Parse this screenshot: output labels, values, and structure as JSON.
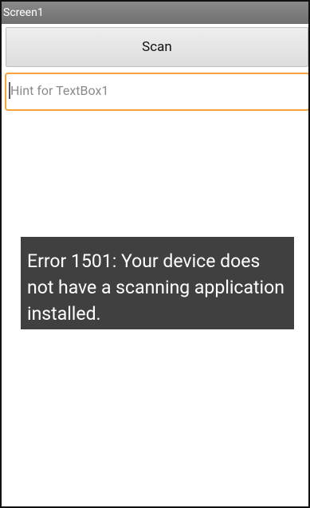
{
  "window": {
    "title": "Screen1"
  },
  "button": {
    "label": "Scan"
  },
  "textbox": {
    "hint": "Hint for TextBox1"
  },
  "toast": {
    "message": "Error 1501: Your device does not have a scanning application installed."
  },
  "colors": {
    "accent": "#f5a23c",
    "toast_background": "#404040",
    "title_bar": "#7b7b7b"
  }
}
